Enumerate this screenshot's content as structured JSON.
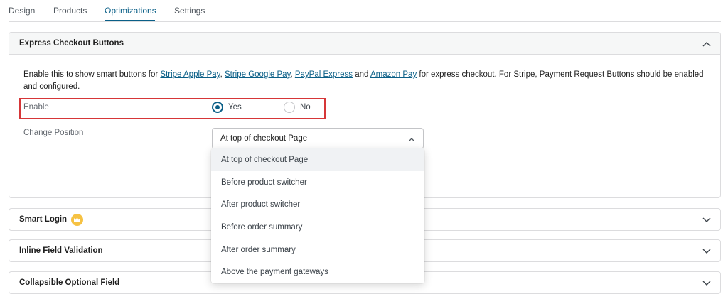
{
  "tabs": [
    {
      "label": "Design"
    },
    {
      "label": "Products"
    },
    {
      "label": "Optimizations"
    },
    {
      "label": "Settings"
    }
  ],
  "active_tab": "Optimizations",
  "express": {
    "title": "Express Checkout Buttons",
    "desc_prefix": "Enable this to show smart buttons for ",
    "link_apple": "Stripe Apple Pay",
    "sep1": ", ",
    "link_google": "Stripe Google Pay",
    "sep2": ", ",
    "link_paypal": "PayPal Express",
    "sep3": " and ",
    "link_amazon": "Amazon Pay",
    "desc_suffix": " for express checkout. For Stripe, Payment Request Buttons should be enabled and configured.",
    "enable_label": "Enable",
    "yes_label": "Yes",
    "no_label": "No",
    "enable_value": "Yes",
    "position_label": "Change Position",
    "position_value": "At top of checkout Page",
    "position_options": [
      "At top of checkout Page",
      "Before product switcher",
      "After product switcher",
      "Before order summary",
      "After order summary",
      "Above the payment gateways"
    ]
  },
  "panels": {
    "smart_login": "Smart Login",
    "inline_validation": "Inline Field Validation",
    "collapsible_optional": "Collapsible Optional Field"
  },
  "icons": {
    "chevron_up": "chevron-up-icon",
    "chevron_down": "chevron-down-icon",
    "crown": "crown-icon"
  },
  "colors": {
    "accent": "#0a5f87",
    "highlight_border": "#d63638",
    "crown": "#f6c243"
  }
}
